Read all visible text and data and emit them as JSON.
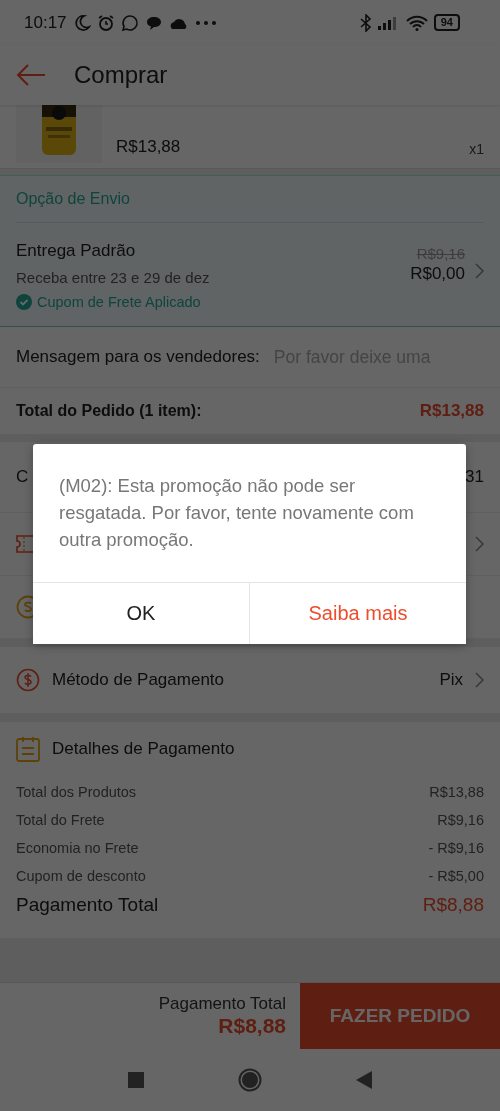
{
  "status_bar": {
    "time": "10:17",
    "battery": "94"
  },
  "header": {
    "title": "Comprar"
  },
  "product": {
    "kind": "picture",
    "price": "R$13,88",
    "quantity": "x1"
  },
  "shipping": {
    "title": "Opção de Envio",
    "method": "Entrega Padrão",
    "delivery": "Receba entre 23 e 29 de dez",
    "old_price": "R$9,16",
    "price": "R$0,00",
    "coupon": "Cupom de Frete Aplicado"
  },
  "message": {
    "label": "Mensagem para os vendedores:",
    "placeholder": "Por favor deixe uma"
  },
  "order_total": {
    "label": "Total do Pedido (1 item):",
    "value": "R$13,88"
  },
  "partial_row": {
    "label": "C",
    "value": "31"
  },
  "payment_method": {
    "label": "Método de Pagamento",
    "value": "Pix"
  },
  "payment_details": {
    "title": "Detalhes de Pagamento",
    "lines": [
      {
        "label": "Total dos Produtos",
        "value": "R$13,88"
      },
      {
        "label": "Total do Frete",
        "value": "R$9,16"
      },
      {
        "label": "Economia no Frete",
        "value": "- R$9,16"
      },
      {
        "label": "Cupom de desconto",
        "value": "- R$5,00"
      }
    ],
    "total": {
      "label": "Pagamento Total",
      "value": "R$8,88"
    }
  },
  "footer": {
    "label": "Pagamento Total",
    "total": "R$8,88",
    "button": "FAZER PEDIDO"
  },
  "dialog": {
    "message": "(M02): Esta promoção não pode ser resgatada. Por favor, tente novamente com outra promoção.",
    "buttons": [
      {
        "label": "OK",
        "kind": "default"
      },
      {
        "label": "Saiba mais",
        "kind": "primary"
      }
    ]
  }
}
